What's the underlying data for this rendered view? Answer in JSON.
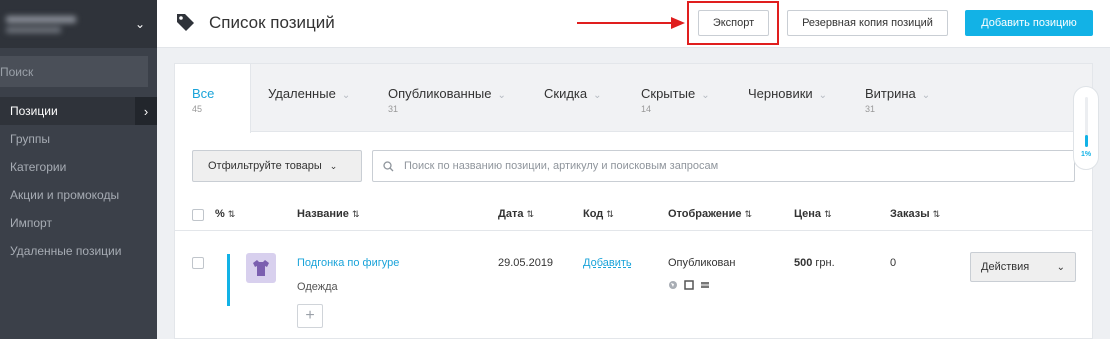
{
  "sidebar": {
    "search_placeholder": "Поиск",
    "items": [
      {
        "label": "Позиции",
        "active": true
      },
      {
        "label": "Группы"
      },
      {
        "label": "Категории"
      },
      {
        "label": "Акции и промокоды"
      },
      {
        "label": "Импорт"
      },
      {
        "label": "Удаленные позиции"
      }
    ]
  },
  "header": {
    "title": "Список позиций",
    "export_label": "Экспорт",
    "backup_label": "Резервная копия позиций",
    "add_label": "Добавить позицию"
  },
  "tabs": [
    {
      "label": "Все",
      "count": "45"
    },
    {
      "label": "Удаленные",
      "count": ""
    },
    {
      "label": "Опубликованные",
      "count": "31"
    },
    {
      "label": "Скидка",
      "count": ""
    },
    {
      "label": "Скрытые",
      "count": "14"
    },
    {
      "label": "Черновики",
      "count": ""
    },
    {
      "label": "Витрина",
      "count": "31"
    }
  ],
  "filter": {
    "label": "Отфильтруйте товары",
    "search_placeholder": "Поиск по названию позиции, артикулу и поисковым запросам"
  },
  "table": {
    "columns": {
      "percent": "%",
      "name": "Название",
      "date": "Дата",
      "code": "Код",
      "display": "Отображение",
      "price": "Цена",
      "orders": "Заказы"
    },
    "rows": [
      {
        "name": "Подгонка по фигуре",
        "group": "Одежда",
        "date": "29.05.2019",
        "code_link": "Добавить",
        "status": "Опубликован",
        "price_value": "500",
        "price_currency": "грн.",
        "orders": "0",
        "actions_label": "Действия"
      }
    ]
  },
  "progress": {
    "percent": 1,
    "label": "1%"
  },
  "colors": {
    "accent": "#12b2e6",
    "sidebar": "#3b4049",
    "highlight": "#e01e1e"
  }
}
